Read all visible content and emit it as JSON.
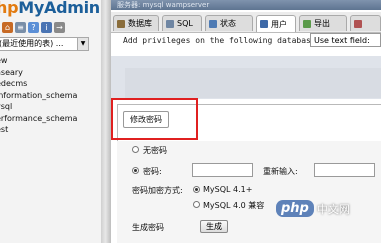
{
  "logo": {
    "part1": "hp",
    "part2": "MyAdmin"
  },
  "nav_icons": [
    "home-icon",
    "sql-icon",
    "docs-icon",
    "help-icon",
    "exit-icon"
  ],
  "db_select": {
    "value": "(最近使用的表) ..."
  },
  "db_list": [
    "ew",
    "aseary",
    "edecms",
    "information_schema",
    "ysql",
    "erformance_schema",
    "est"
  ],
  "breadcrumb": "服务器: mysql wampserver",
  "tabs": [
    {
      "label": "数据库",
      "icon": "database-icon"
    },
    {
      "label": "SQL",
      "icon": "sql-icon"
    },
    {
      "label": "状态",
      "icon": "status-icon"
    },
    {
      "label": "用户",
      "icon": "users-icon"
    },
    {
      "label": "导出",
      "icon": "export-icon"
    }
  ],
  "privileges": {
    "text": "Add privileges on the following database:",
    "select_value": "Use text field:"
  },
  "password_section": {
    "title": "修改密码",
    "no_password": "无密码",
    "password_label": "密码:",
    "reenter_label": "重新输入:",
    "hashing_label": "密码加密方式:",
    "hash_option1": "MySQL 4.1+",
    "hash_option2": "MySQL 4.0 兼容",
    "generate_label": "生成密码",
    "generate_button": "生成"
  },
  "watermark": {
    "logo": "php",
    "site": "中文网"
  },
  "colors": {
    "highlight": "#e02020",
    "logo_orange": "#e27b10",
    "logo_blue": "#1c5f9a"
  }
}
